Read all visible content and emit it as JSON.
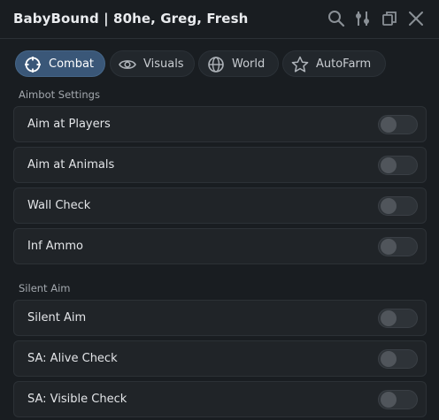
{
  "window": {
    "title": "BabyBound | 80he, Greg, Fresh"
  },
  "titlebar_icons": [
    "search-icon",
    "sliders-icon",
    "restore-icon",
    "close-icon"
  ],
  "tabs": [
    {
      "label": "Combat",
      "icon": "crosshair-icon",
      "active": true
    },
    {
      "label": "Visuals",
      "icon": "eye-icon",
      "active": false
    },
    {
      "label": "World",
      "icon": "globe-icon",
      "active": false
    },
    {
      "label": "AutoFarm",
      "icon": "star-icon",
      "active": false
    }
  ],
  "sections": {
    "aimbot": {
      "label": "Aimbot Settings",
      "toggles": [
        {
          "label": "Aim at Players",
          "on": false
        },
        {
          "label": "Aim at Animals",
          "on": false
        },
        {
          "label": "Wall Check",
          "on": false
        },
        {
          "label": "Inf Ammo",
          "on": false
        }
      ]
    },
    "silent": {
      "label": "Silent Aim",
      "toggles": [
        {
          "label": "Silent Aim",
          "on": false
        },
        {
          "label": "SA: Alive Check",
          "on": false
        },
        {
          "label": "SA: Visible Check",
          "on": false
        }
      ]
    }
  },
  "colors": {
    "background": "#191d21",
    "active_tab": "#3a5778",
    "row": "#202428",
    "toggle_off": "#2e3338"
  }
}
